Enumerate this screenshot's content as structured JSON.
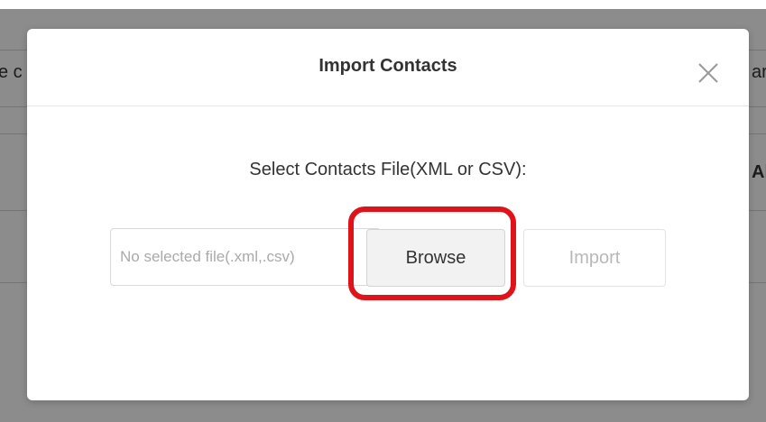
{
  "background": {
    "left_fragment_1": "e c",
    "right_fragment_1": "ar",
    "right_fragment_2": "Al"
  },
  "modal": {
    "title": "Import Contacts",
    "close_glyph": "×",
    "prompt": "Select Contacts File(XML or CSV):",
    "file_input": {
      "value": "",
      "placeholder": "No selected file(.xml,.csv)"
    },
    "browse_label": "Browse",
    "import_label": "Import",
    "import_disabled": true
  },
  "colors": {
    "highlight": "#e0131b",
    "overlay": "rgba(0,0,0,0.45)"
  },
  "icons": {
    "close": "close-icon"
  }
}
